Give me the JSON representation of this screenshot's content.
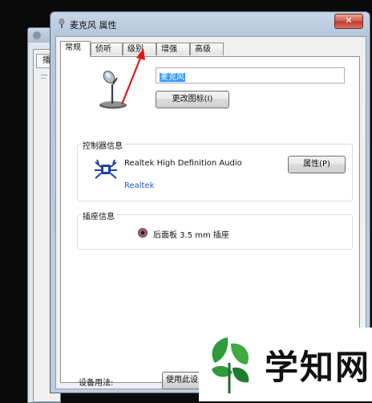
{
  "background_window": {
    "tab_label": "播"
  },
  "window": {
    "title": "麦克风 属性",
    "close_glyph": "✕"
  },
  "tabs": [
    {
      "label": "常规",
      "active": true
    },
    {
      "label": "侦听",
      "active": false
    },
    {
      "label": "级别",
      "active": false
    },
    {
      "label": "增强",
      "active": false
    },
    {
      "label": "高级",
      "active": false
    }
  ],
  "general": {
    "device_name": "麦克风",
    "change_icon_label": "更改图标(I)"
  },
  "controller": {
    "legend": "控制器信息",
    "name": "Realtek High Definition Audio",
    "vendor": "Realtek",
    "properties_label": "属性(P)"
  },
  "jack": {
    "legend": "插座信息",
    "label": "后面板 3.5 mm 插座"
  },
  "usage": {
    "label": "设备用法:",
    "value": "使用此设备"
  },
  "watermark": {
    "text": "学知网"
  },
  "colors": {
    "arrow": "#e01a1a",
    "leaf_green": "#2e9a3a",
    "link_blue": "#1a5fb4",
    "selection": "#3399ff"
  },
  "icons": [
    "microphone-icon",
    "realtek-crab-icon",
    "audio-jack-icon",
    "window-icon",
    "close-icon"
  ]
}
